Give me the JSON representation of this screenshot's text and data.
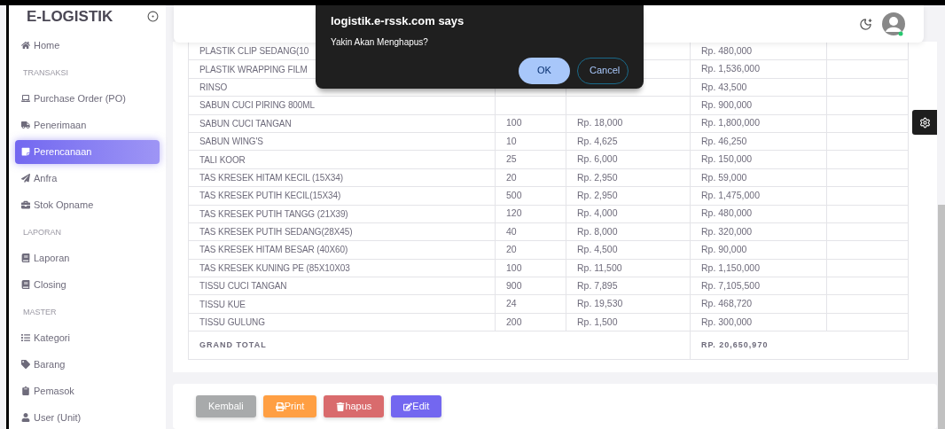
{
  "sidebar": {
    "brand": "E-LOGISTIK",
    "entries": [
      {
        "kind": "item",
        "label": "Home",
        "selected": false
      },
      {
        "kind": "header",
        "label": "TRANSAKSI"
      },
      {
        "kind": "item",
        "label": "Purchase Order (PO)",
        "selected": false
      },
      {
        "kind": "item",
        "label": "Penerimaan",
        "selected": false
      },
      {
        "kind": "item",
        "label": "Perencanaan",
        "selected": true
      },
      {
        "kind": "item",
        "label": "Anfra",
        "selected": false
      },
      {
        "kind": "item",
        "label": "Stok Opname",
        "selected": false
      },
      {
        "kind": "header",
        "label": "LAPORAN"
      },
      {
        "kind": "item",
        "label": "Laporan",
        "selected": false
      },
      {
        "kind": "item",
        "label": "Closing",
        "selected": false
      },
      {
        "kind": "header",
        "label": "MASTER"
      },
      {
        "kind": "item",
        "label": "Kategori",
        "selected": false
      },
      {
        "kind": "item",
        "label": "Barang",
        "selected": false
      },
      {
        "kind": "item",
        "label": "Pemasok",
        "selected": false
      },
      {
        "kind": "item",
        "label": "User (Unit)",
        "selected": false
      }
    ]
  },
  "table": {
    "rows": [
      {
        "name": "PLASTIK CLIP SEDANG(10",
        "total": "Rp. 480,000"
      },
      {
        "name": "PLASTIK WRAPPING FILM",
        "total": "Rp. 1,536,000"
      },
      {
        "name": "RINSO",
        "total": "Rp. 43,500"
      },
      {
        "name": "SABUN CUCI PIRING 800ML",
        "total": "Rp. 900,000"
      },
      {
        "name": "SABUN CUCI TANGAN",
        "qty": "100",
        "price": "Rp. 18,000",
        "total": "Rp. 1,800,000"
      },
      {
        "name": "SABUN WING'S",
        "qty": "10",
        "price": "Rp. 4,625",
        "total": "Rp. 46,250"
      },
      {
        "name": "TALI KOOR",
        "qty": "25",
        "price": "Rp. 6,000",
        "total": "Rp. 150,000"
      },
      {
        "name": "TAS KRESEK HITAM KECIL (15X34)",
        "qty": "20",
        "price": "Rp. 2,950",
        "total": "Rp. 59,000"
      },
      {
        "name": "TAS KRESEK PUTIH KECIL(15X34)",
        "qty": "500",
        "price": "Rp. 2,950",
        "total": "Rp. 1,475,000"
      },
      {
        "name": "TAS KRESEK PUTIH TANGG (21X39)",
        "qty": "120",
        "price": "Rp. 4,000",
        "total": "Rp. 480,000"
      },
      {
        "name": "TAS KRESEK PUTIH SEDANG(28X45)",
        "qty": "40",
        "price": "Rp. 8,000",
        "total": "Rp. 320,000"
      },
      {
        "name": "TAS KRESEK HITAM BESAR (40X60)",
        "qty": "20",
        "price": "Rp. 4,500",
        "total": "Rp. 90,000"
      },
      {
        "name": "TAS KRESEK KUNING PE (85X10X03",
        "qty": "100",
        "price": "Rp. 11,500",
        "total": "Rp. 1,150,000"
      },
      {
        "name": "TISSU CUCI TANGAN",
        "qty": "900",
        "price": "Rp. 7,895",
        "total": "Rp. 7,105,500"
      },
      {
        "name": "TISSU KUE",
        "qty": "24",
        "price": "Rp. 19,530",
        "total": "Rp. 468,720"
      },
      {
        "name": "TISSU GULUNG",
        "qty": "200",
        "price": "Rp. 1,500",
        "total": "Rp. 300,000"
      }
    ],
    "grand_total_label": "GRAND TOTAL",
    "grand_total": "RP. 20,650,970"
  },
  "actions": [
    {
      "kind": "back",
      "label": "Kembali"
    },
    {
      "kind": "print",
      "label": "Print"
    },
    {
      "kind": "delete",
      "label": "hapus"
    },
    {
      "kind": "edit",
      "label": "Edit"
    }
  ],
  "dialog": {
    "title": "logistik.e-rssk.com says",
    "message": "Yakin Akan Menghapus?",
    "buttons": [
      {
        "kind": "primary",
        "label": "OK"
      },
      {
        "kind": "secondary",
        "label": "Cancel"
      }
    ]
  }
}
